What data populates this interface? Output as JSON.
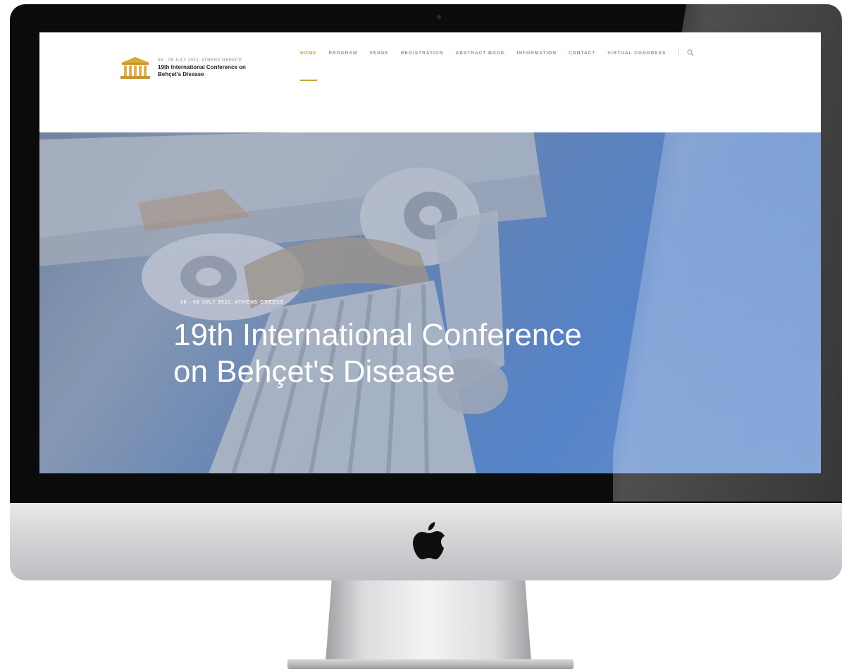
{
  "header": {
    "logo": {
      "date": "06 - 08 JULY 2022, ATHENS GREECE",
      "title": "19th International Conference on Behçet's Disease"
    },
    "nav": [
      {
        "label": "HOME",
        "active": true
      },
      {
        "label": "PROGRAM",
        "active": false
      },
      {
        "label": "VENUE",
        "active": false
      },
      {
        "label": "REGISTRATION",
        "active": false
      },
      {
        "label": "ABSTRACT BOOK",
        "active": false
      },
      {
        "label": "INFORMATION",
        "active": false
      },
      {
        "label": "CONTACT",
        "active": false
      },
      {
        "label": "VIRTUAL CONGRESS",
        "active": false
      }
    ],
    "search_icon": "search-icon"
  },
  "hero": {
    "kicker": "06 - 08 JULY 2022, ATHENS GREECE",
    "title": "19th International Conference on Behçet's Disease"
  },
  "colors": {
    "accent": "#c8a23a",
    "hero_blue": "#5f8fd6",
    "bezel": "#0b0b0b"
  },
  "icons": [
    "temple-logo-icon",
    "search-icon",
    "apple-logo-icon"
  ]
}
